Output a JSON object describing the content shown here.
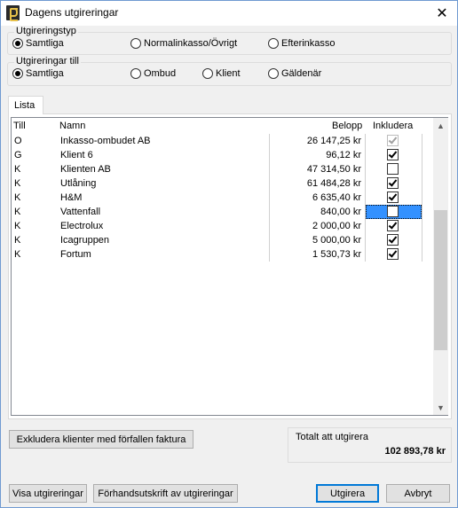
{
  "window": {
    "title": "Dagens utgireringar",
    "close_glyph": "✕"
  },
  "utgireringstyp": {
    "label": "Utgireringstyp",
    "options": [
      {
        "label": "Samtliga",
        "checked": true
      },
      {
        "label": "Normalinkasso/Övrigt",
        "checked": false
      },
      {
        "label": "Efterinkasso",
        "checked": false
      }
    ]
  },
  "utgireringar_till": {
    "label": "Utgireringar till",
    "options": [
      {
        "label": "Samtliga",
        "checked": true
      },
      {
        "label": "Ombud",
        "checked": false
      },
      {
        "label": "Klient",
        "checked": false
      },
      {
        "label": "Gäldenär",
        "checked": false
      }
    ]
  },
  "tabs": [
    {
      "label": "Lista",
      "active": true
    }
  ],
  "table": {
    "columns": {
      "till": "Till",
      "namn": "Namn",
      "belopp": "Belopp",
      "inkludera": "Inkludera"
    },
    "rows": [
      {
        "till": "O",
        "namn": "Inkasso-ombudet AB",
        "belopp": "26 147,25 kr",
        "inkludera": true,
        "disabled": true,
        "selected": false
      },
      {
        "till": "G",
        "namn": "Klient 6",
        "belopp": "96,12 kr",
        "inkludera": true,
        "disabled": false,
        "selected": false
      },
      {
        "till": "K",
        "namn": "Klienten AB",
        "belopp": "47 314,50 kr",
        "inkludera": false,
        "disabled": false,
        "selected": false
      },
      {
        "till": "K",
        "namn": "Utlåning",
        "belopp": "61 484,28 kr",
        "inkludera": true,
        "disabled": false,
        "selected": false
      },
      {
        "till": "K",
        "namn": "H&M",
        "belopp": "6 635,40 kr",
        "inkludera": true,
        "disabled": false,
        "selected": false
      },
      {
        "till": "K",
        "namn": "Vattenfall",
        "belopp": "840,00 kr",
        "inkludera": false,
        "disabled": false,
        "selected": true
      },
      {
        "till": "K",
        "namn": "Electrolux",
        "belopp": "2 000,00 kr",
        "inkludera": true,
        "disabled": false,
        "selected": false
      },
      {
        "till": "K",
        "namn": "Icagruppen",
        "belopp": "5 000,00 kr",
        "inkludera": true,
        "disabled": false,
        "selected": false
      },
      {
        "till": "K",
        "namn": "Fortum",
        "belopp": "1 530,73 kr",
        "inkludera": true,
        "disabled": false,
        "selected": false
      }
    ]
  },
  "scrollbar": {
    "up_glyph": "▲",
    "down_glyph": "▼"
  },
  "buttons": {
    "exclude": "Exkludera klienter med förfallen faktura",
    "show": "Visa utgireringar",
    "preview": "Förhandsutskrift av utgireringar",
    "execute": "Utgirera",
    "cancel": "Avbryt"
  },
  "total": {
    "label": "Totalt att utgirera",
    "value": "102 893,78 kr"
  },
  "colors": {
    "selection": "#3391ff",
    "default_button_border": "#0078d7"
  }
}
